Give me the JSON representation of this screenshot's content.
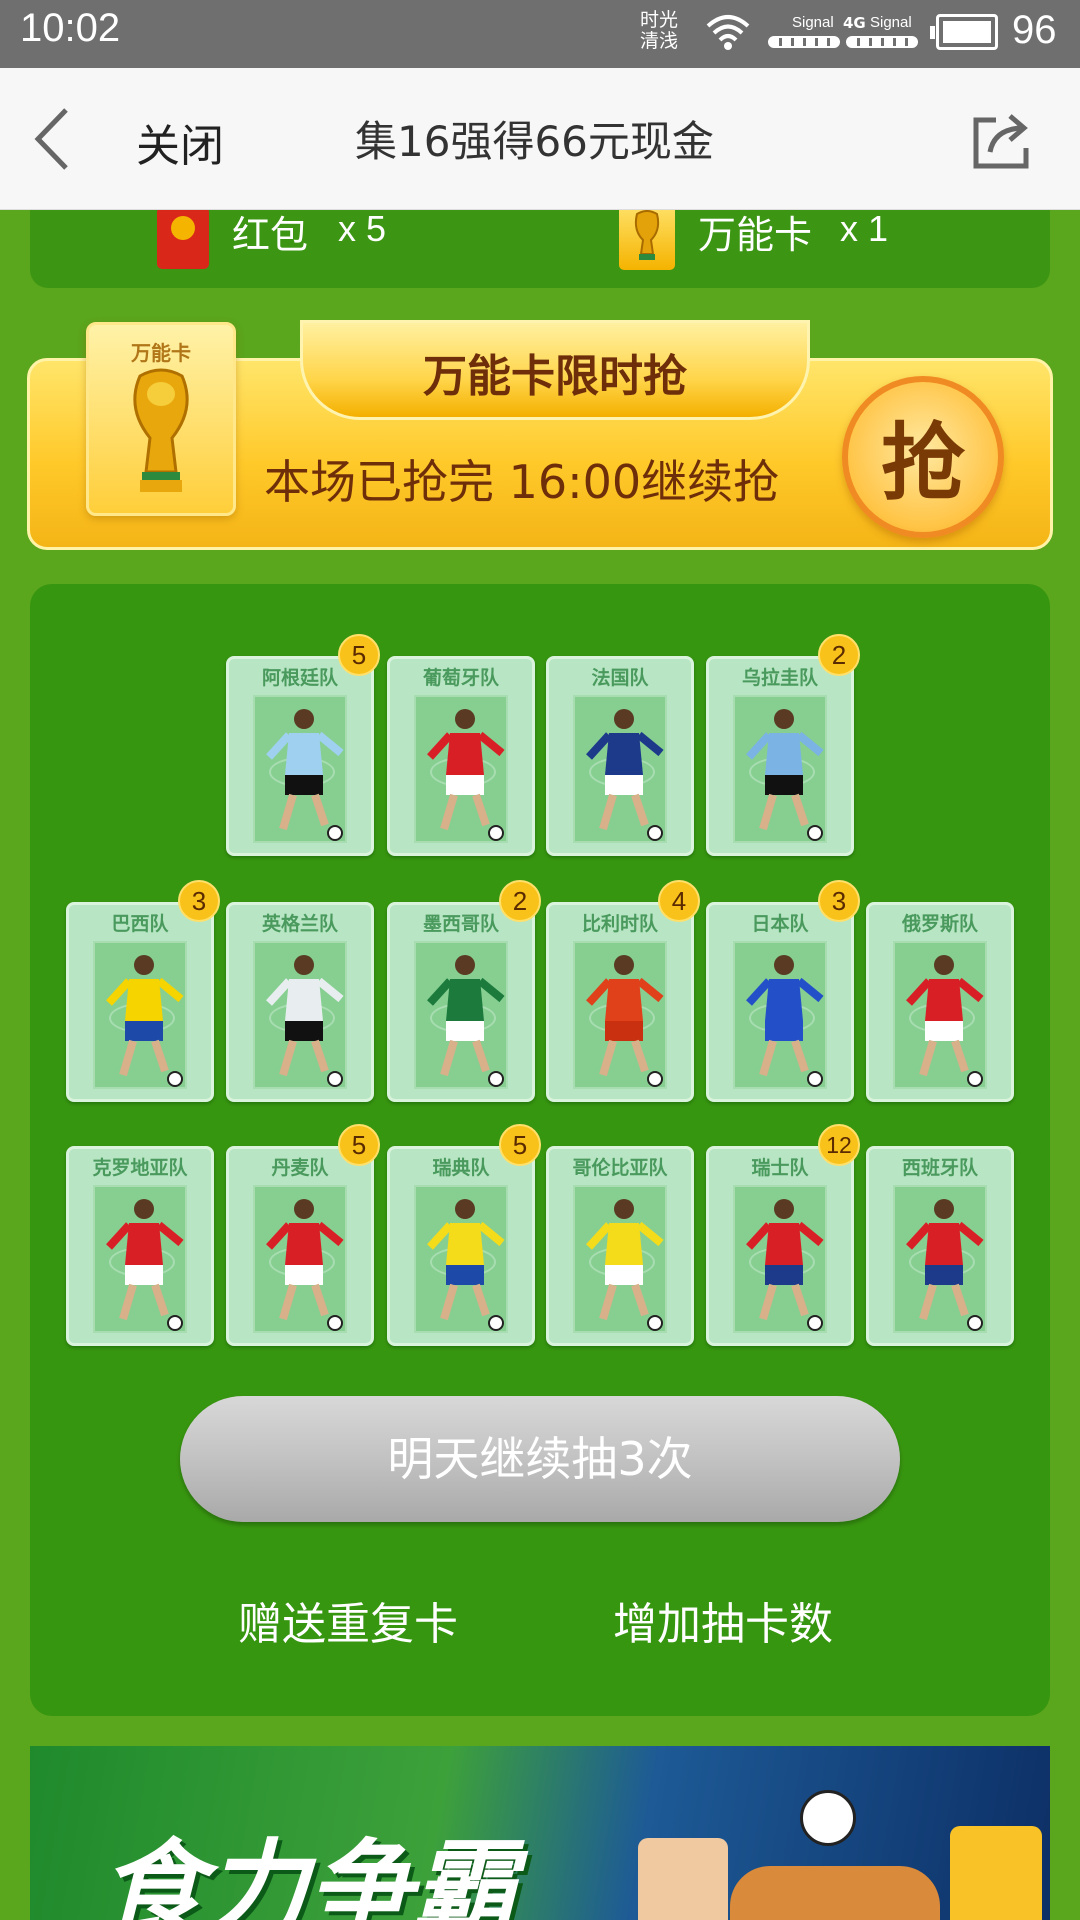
{
  "status_bar": {
    "time": "10:02",
    "carrier_line1": "时光",
    "carrier_line2": "清浅",
    "signal1": "Signal",
    "network": "4G",
    "signal2": "Signal",
    "battery": "96"
  },
  "nav": {
    "close_label": "关闭",
    "title": "集16强得66元现金"
  },
  "rewards": {
    "red_packet_label": "红包",
    "red_packet_count": "x 5",
    "wild_card_label": "万能卡",
    "wild_card_count": "x 1"
  },
  "promo": {
    "card_label": "万能卡",
    "title": "万能卡限时抢",
    "subtitle": "本场已抢完 16:00继续抢",
    "grab_button": "抢"
  },
  "teams": [
    {
      "name": "阿根廷队",
      "count": "5",
      "shirt": "#9fd0f0",
      "shorts": "#111111"
    },
    {
      "name": "葡萄牙队",
      "count": "",
      "shirt": "#d91f26",
      "shorts": "#ffffff"
    },
    {
      "name": "法国队",
      "count": "",
      "shirt": "#1d3a8a",
      "shorts": "#ffffff"
    },
    {
      "name": "乌拉圭队",
      "count": "2",
      "shirt": "#7bb3e4",
      "shorts": "#111111"
    },
    {
      "name": "巴西队",
      "count": "3",
      "shirt": "#f5d400",
      "shorts": "#1d4aa8"
    },
    {
      "name": "英格兰队",
      "count": "",
      "shirt": "#e8eef0",
      "shorts": "#111111"
    },
    {
      "name": "墨西哥队",
      "count": "2",
      "shirt": "#1b7a3c",
      "shorts": "#ffffff"
    },
    {
      "name": "比利时队",
      "count": "4",
      "shirt": "#e0401a",
      "shorts": "#c8300f"
    },
    {
      "name": "日本队",
      "count": "3",
      "shirt": "#2350c8",
      "shorts": "#2350c8"
    },
    {
      "name": "俄罗斯队",
      "count": "",
      "shirt": "#d91f26",
      "shorts": "#ffffff"
    },
    {
      "name": "克罗地亚队",
      "count": "",
      "shirt": "#d91f26",
      "shorts": "#ffffff"
    },
    {
      "name": "丹麦队",
      "count": "5",
      "shirt": "#d91f26",
      "shorts": "#ffffff"
    },
    {
      "name": "瑞典队",
      "count": "5",
      "shirt": "#f5dc1a",
      "shorts": "#1d4aa8"
    },
    {
      "name": "哥伦比亚队",
      "count": "",
      "shirt": "#f5dc1a",
      "shorts": "#ffffff"
    },
    {
      "name": "瑞士队",
      "count": "12",
      "shirt": "#d91f26",
      "shorts": "#1d3a8a"
    },
    {
      "name": "西班牙队",
      "count": "",
      "shirt": "#d91f26",
      "shorts": "#1d3a8a"
    }
  ],
  "actions": {
    "draw_button": "明天继续抽3次",
    "gift_duplicates": "赠送重复卡",
    "add_draws": "增加抽卡数"
  },
  "ad": {
    "title": "食力争霸"
  },
  "colors": {
    "page_bg": "#5aa61c",
    "panel_bg": "#379610",
    "promo_gold": "#ffc92a",
    "badge_yellow": "#f9c21a"
  }
}
